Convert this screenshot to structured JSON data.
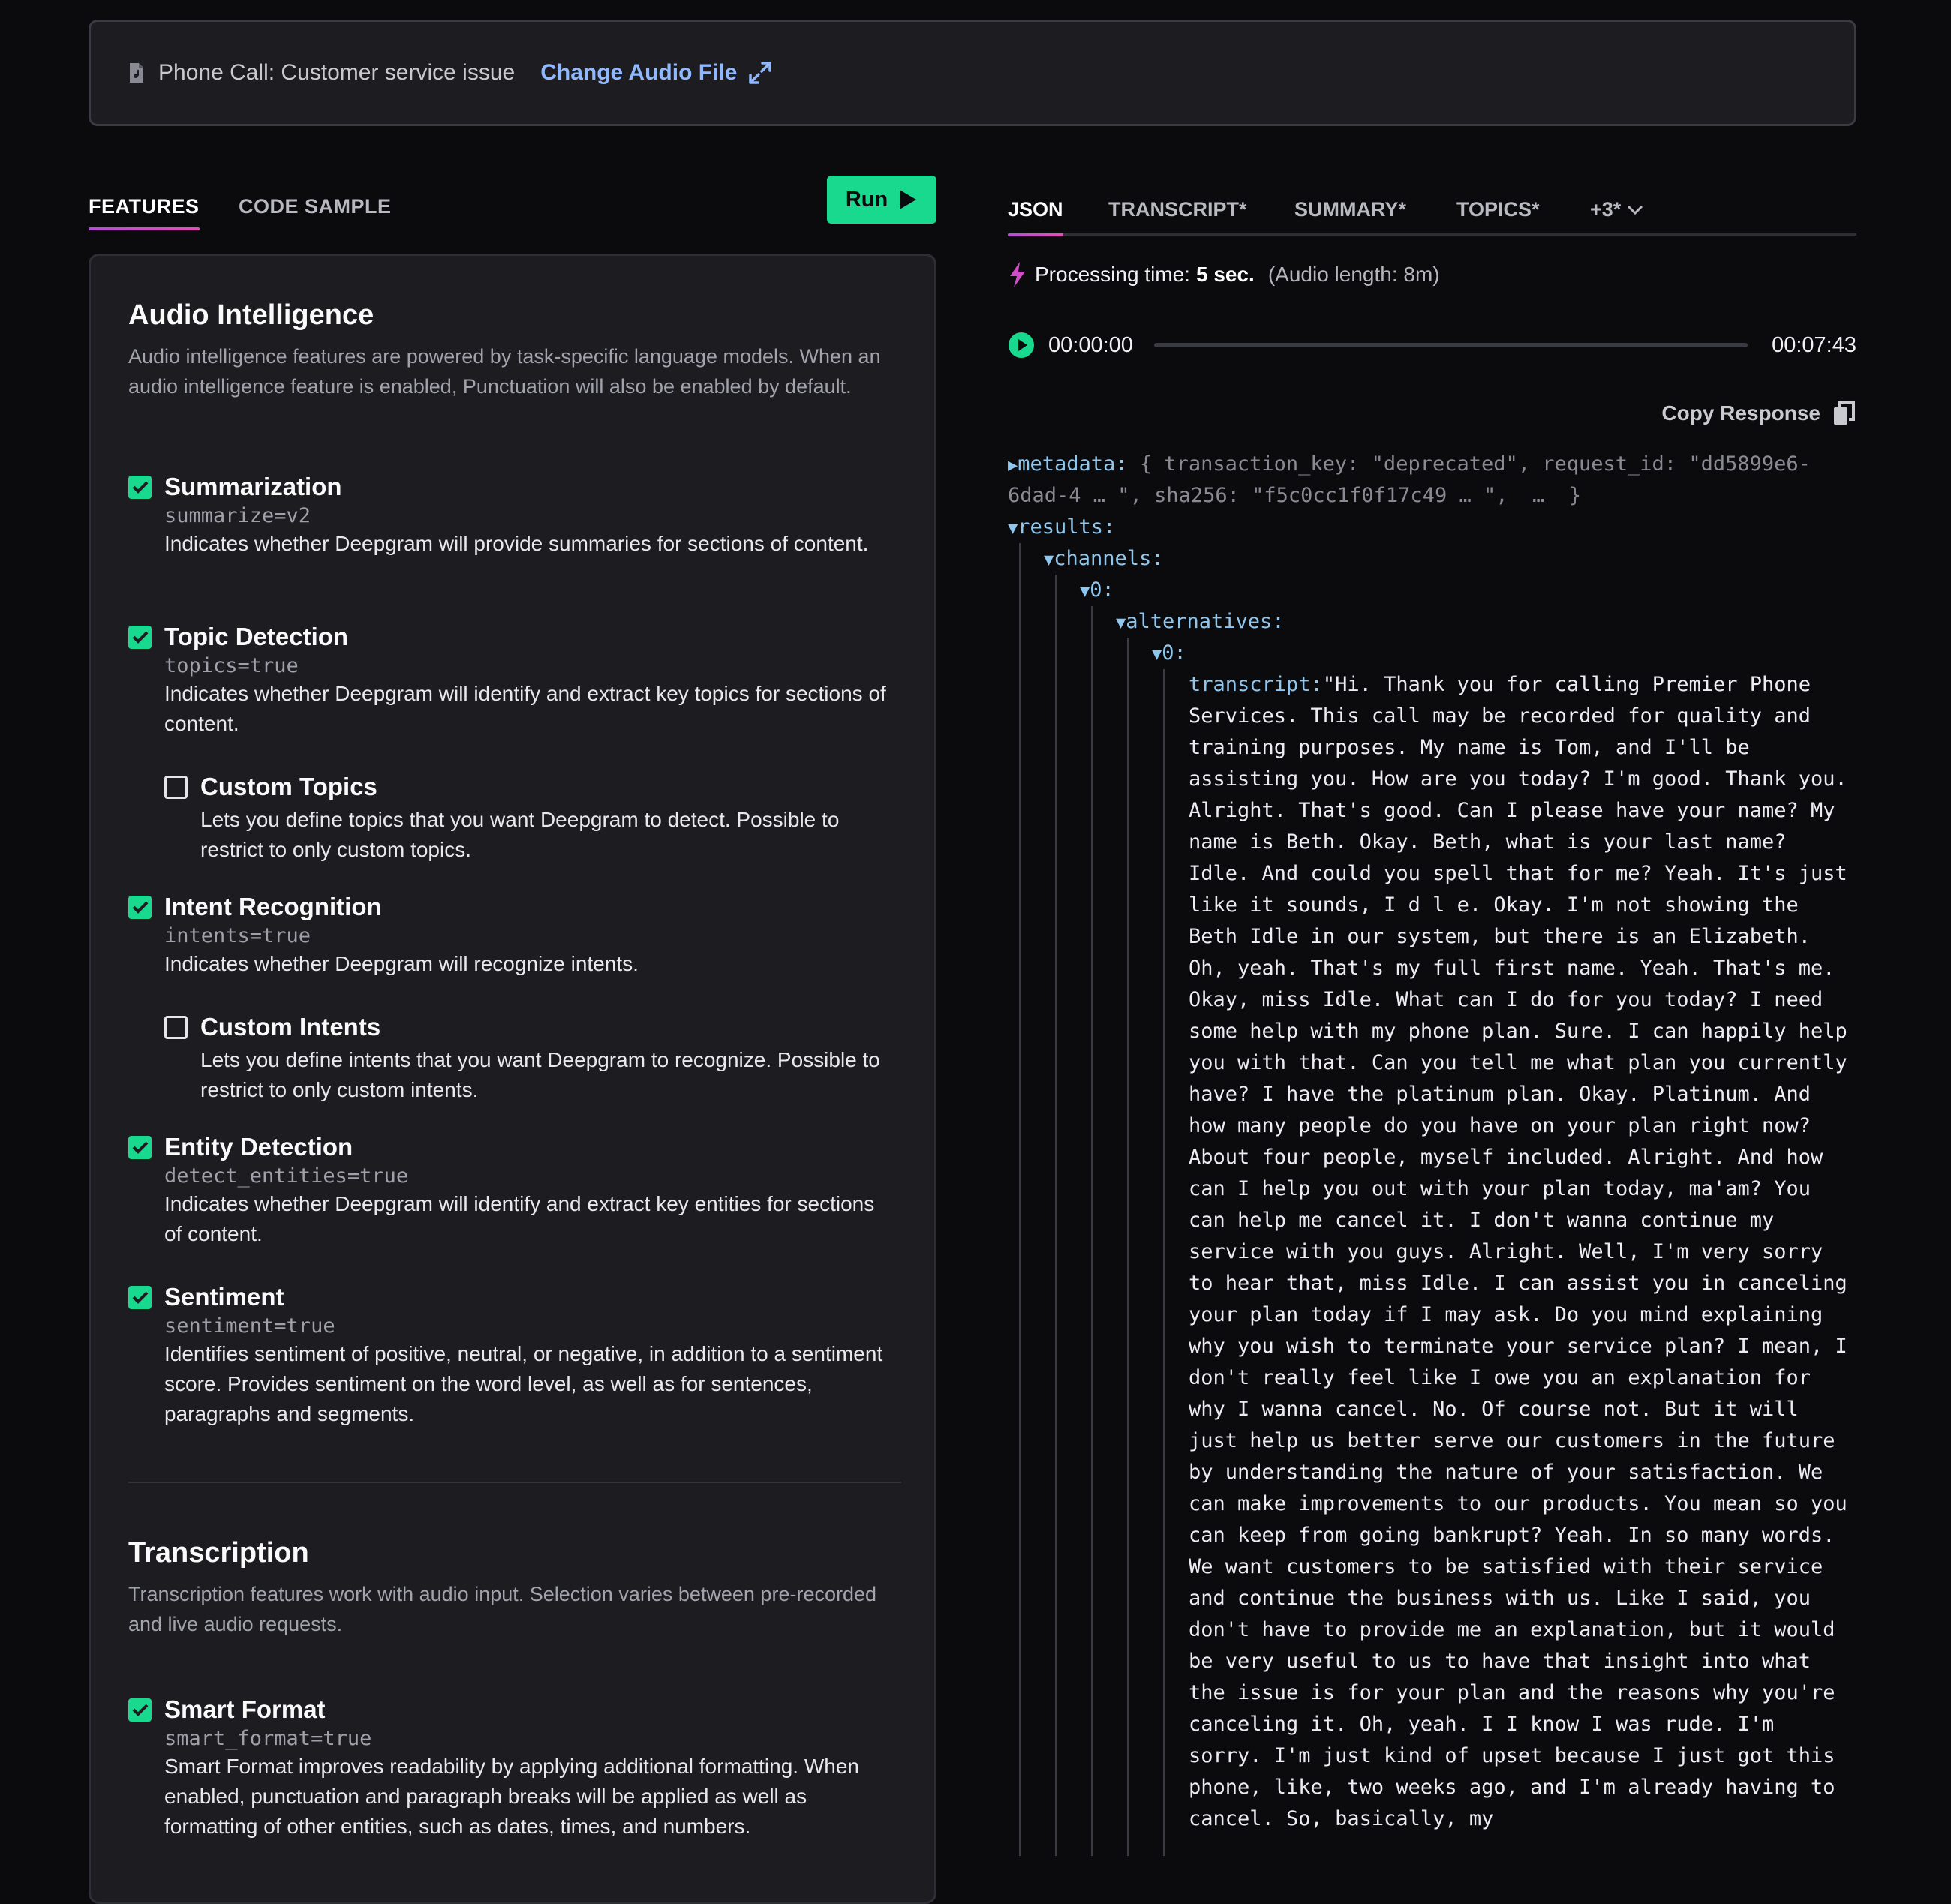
{
  "header": {
    "file_name": "Phone Call: Customer service issue",
    "change_link": "Change Audio File"
  },
  "left_tabs": {
    "features": "FEATURES",
    "code_sample": "CODE SAMPLE",
    "run": "Run"
  },
  "audio_intelligence": {
    "title": "Audio Intelligence",
    "description": "Audio intelligence features are powered by task-specific language models. When an audio intelligence feature is enabled, Punctuation will also be enabled by default.",
    "features": [
      {
        "title": "Summarization",
        "param": "summarize=v2",
        "desc": "Indicates whether Deepgram will provide summaries for sections of content.",
        "checked": true
      },
      {
        "title": "Topic Detection",
        "param": "topics=true",
        "desc": "Indicates whether Deepgram will identify and extract key topics for sections of content.",
        "checked": true
      },
      {
        "title": "Custom Topics",
        "desc": "Lets you define topics that you want Deepgram to detect. Possible to restrict to only custom topics.",
        "checked": false
      },
      {
        "title": "Intent Recognition",
        "param": "intents=true",
        "desc": "Indicates whether Deepgram will recognize intents.",
        "checked": true
      },
      {
        "title": "Custom Intents",
        "desc": "Lets you define intents that you want Deepgram to recognize. Possible to restrict to only custom intents.",
        "checked": false
      },
      {
        "title": "Entity Detection",
        "param": "detect_entities=true",
        "desc": "Indicates whether Deepgram will identify and extract key entities for sections of content.",
        "checked": true
      },
      {
        "title": "Sentiment",
        "param": "sentiment=true",
        "desc": "Identifies sentiment of positive, neutral, or negative, in addition to a sentiment score. Provides sentiment on the word level, as well as for sentences, paragraphs and segments.",
        "checked": true
      }
    ]
  },
  "transcription": {
    "title": "Transcription",
    "description": "Transcription features work with audio input. Selection varies between pre-recorded and live audio requests.",
    "features": [
      {
        "title": "Smart Format",
        "param": "smart_format=true",
        "desc": "Smart Format improves readability by applying additional formatting. When enabled, punctuation and paragraph breaks will be applied as well as formatting of other entities, such as dates, times, and numbers.",
        "checked": true
      }
    ]
  },
  "right_tabs": [
    "JSON",
    "TRANSCRIPT*",
    "SUMMARY*",
    "TOPICS*",
    "+3*"
  ],
  "processing": {
    "label": "Processing time:",
    "value": "5 sec.",
    "audio_length": "(Audio length: 8m)"
  },
  "player": {
    "current": "00:00:00",
    "total": "00:07:43",
    "progress": 0
  },
  "copy_response": "Copy Response",
  "json_view": {
    "metadata_key": "metadata:",
    "metadata_line1": "{ transaction_key: \"deprecated\", request_id: \"dd5899e6-",
    "metadata_line2": "6dad-4 … \", sha256: \"f5c0cc1f0f17c49 … \",  …  }",
    "results_key": "results:",
    "channels_key": "channels:",
    "index0": "0:",
    "alternatives_key": "alternatives:",
    "index0b": "0:",
    "transcript_key": "transcript:",
    "transcript_value": "\"Hi. Thank you for calling Premier Phone Services. This call may be recorded for quality and training purposes. My name is Tom, and I'll be assisting you. How are you today? I'm good. Thank you. Alright. That's good. Can I please have your name? My name is Beth. Okay. Beth, what is your last name? Idle. And could you spell that for me? Yeah. It's just like it sounds, I d l e. Okay. I'm not showing the Beth Idle in our system, but there is an Elizabeth. Oh, yeah. That's my full first name. Yeah. That's me. Okay, miss Idle. What can I do for you today? I need some help with my phone plan. Sure. I can happily help you with that. Can you tell me what plan you currently have? I have the platinum plan. Okay. Platinum. And how many people do you have on your plan right now? About four people, myself included. Alright. And how can I help you out with your plan today, ma'am? You can help me cancel it. I don't wanna continue my service with you guys. Alright. Well, I'm very sorry to hear that, miss Idle. I can assist you in canceling your plan today if I may ask. Do you mind explaining why you wish to terminate your service plan? I mean, I don't really feel like I owe you an explanation for why I wanna cancel. No. Of course not. But it will just help us better serve our customers in the future by understanding the nature of your satisfaction. We can make improvements to our products. You mean so you can keep from going bankrupt? Yeah. In so many words. We want customers to be satisfied with their service and continue the business with us. Like I said, you don't have to provide me an explanation, but it would be very useful to us to have that insight into what the issue is for your plan and the reasons why you're canceling it. Oh, yeah. I I know I was rude. I'm sorry. I'm just kind of upset because I just got this phone, like, two weeks ago, and I'm already having to cancel. So, basically, my"
  },
  "colors": {
    "accent_green": "#19d98e",
    "link_blue": "#8fb8ff",
    "tab_underline": "#d04dc8",
    "json_key": "#8fc7ef"
  }
}
